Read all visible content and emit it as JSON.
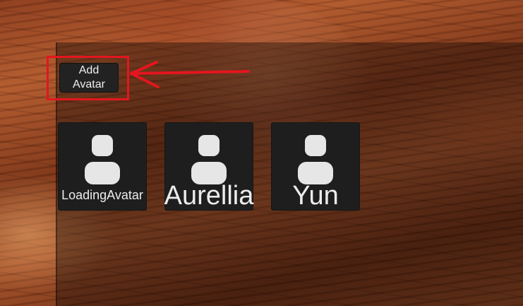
{
  "toolbar": {
    "add_avatar_label": "Add\nAvatar"
  },
  "avatars": [
    {
      "name": "LoadingAvatar",
      "icon": "user-icon"
    },
    {
      "name": "Aurellia",
      "icon": "user-icon"
    },
    {
      "name": "Yun",
      "icon": "user-icon"
    }
  ],
  "annotation": {
    "highlight_color": "#e3161f"
  },
  "colors": {
    "card_bg": "#1e1e1e",
    "icon_fill": "#e6e6e6",
    "text": "#ececec"
  }
}
